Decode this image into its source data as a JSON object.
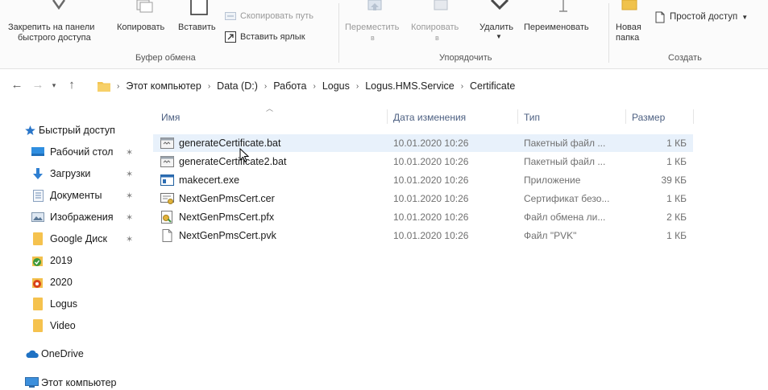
{
  "ribbon": {
    "pin_label_line1": "Закрепить на панели",
    "pin_label_line2": "быстрого доступа",
    "copy_label": "Копировать",
    "paste_label": "Вставить",
    "copy_path_label": "Скопировать путь",
    "paste_shortcut_label": "Вставить ярлык",
    "clipboard_group": "Буфер обмена",
    "move_label_line1": "Переместить",
    "move_label_line2": "в",
    "copyto_label_line1": "Копировать",
    "copyto_label_line2": "в",
    "delete_label": "Удалить",
    "rename_label": "Переименовать",
    "organize_group": "Упорядочить",
    "new_folder_line1": "Новая",
    "new_folder_line2": "папка",
    "easy_access_label": "Простой доступ",
    "create_group": "Создать"
  },
  "address": {
    "crumbs": [
      "Этот компьютер",
      "Data (D:)",
      "Работа",
      "Logus",
      "Logus.HMS.Service",
      "Certificate"
    ]
  },
  "sidebar": {
    "items": [
      {
        "label": "Быстрый доступ",
        "icon": "star-icon"
      },
      {
        "label": "Рабочий стол",
        "icon": "desktop-icon",
        "pinned": true
      },
      {
        "label": "Загрузки",
        "icon": "download-icon",
        "pinned": true
      },
      {
        "label": "Документы",
        "icon": "document-icon",
        "pinned": true
      },
      {
        "label": "Изображения",
        "icon": "pictures-icon",
        "pinned": true
      },
      {
        "label": "Google Диск",
        "icon": "folder-icon",
        "pinned": true
      },
      {
        "label": "2019",
        "icon": "folder-badge-icon"
      },
      {
        "label": "2020",
        "icon": "folder-badge-icon"
      },
      {
        "label": "Logus",
        "icon": "folder-icon"
      },
      {
        "label": "Video",
        "icon": "folder-icon"
      },
      {
        "label": "OneDrive",
        "icon": "cloud-icon"
      },
      {
        "label": "Этот компьютер",
        "icon": "computer-icon"
      }
    ]
  },
  "columns": {
    "name": "Имя",
    "date": "Дата изменения",
    "type": "Тип",
    "size": "Размер"
  },
  "files": [
    {
      "name": "generateCertificate.bat",
      "date": "10.01.2020 10:26",
      "type": "Пакетный файл ...",
      "size": "1 КБ",
      "icon": "batch-file-icon"
    },
    {
      "name": "generateCertificate2.bat",
      "date": "10.01.2020 10:26",
      "type": "Пакетный файл ...",
      "size": "1 КБ",
      "icon": "batch-file-icon"
    },
    {
      "name": "makecert.exe",
      "date": "10.01.2020 10:26",
      "type": "Приложение",
      "size": "39 КБ",
      "icon": "exe-file-icon"
    },
    {
      "name": "NextGenPmsCert.cer",
      "date": "10.01.2020 10:26",
      "type": "Сертификат безо...",
      "size": "1 КБ",
      "icon": "certificate-file-icon"
    },
    {
      "name": "NextGenPmsCert.pfx",
      "date": "10.01.2020 10:26",
      "type": "Файл обмена ли...",
      "size": "2 КБ",
      "icon": "pfx-file-icon"
    },
    {
      "name": "NextGenPmsCert.pvk",
      "date": "10.01.2020 10:26",
      "type": "Файл \"PVK\"",
      "size": "1 КБ",
      "icon": "blank-file-icon"
    }
  ]
}
